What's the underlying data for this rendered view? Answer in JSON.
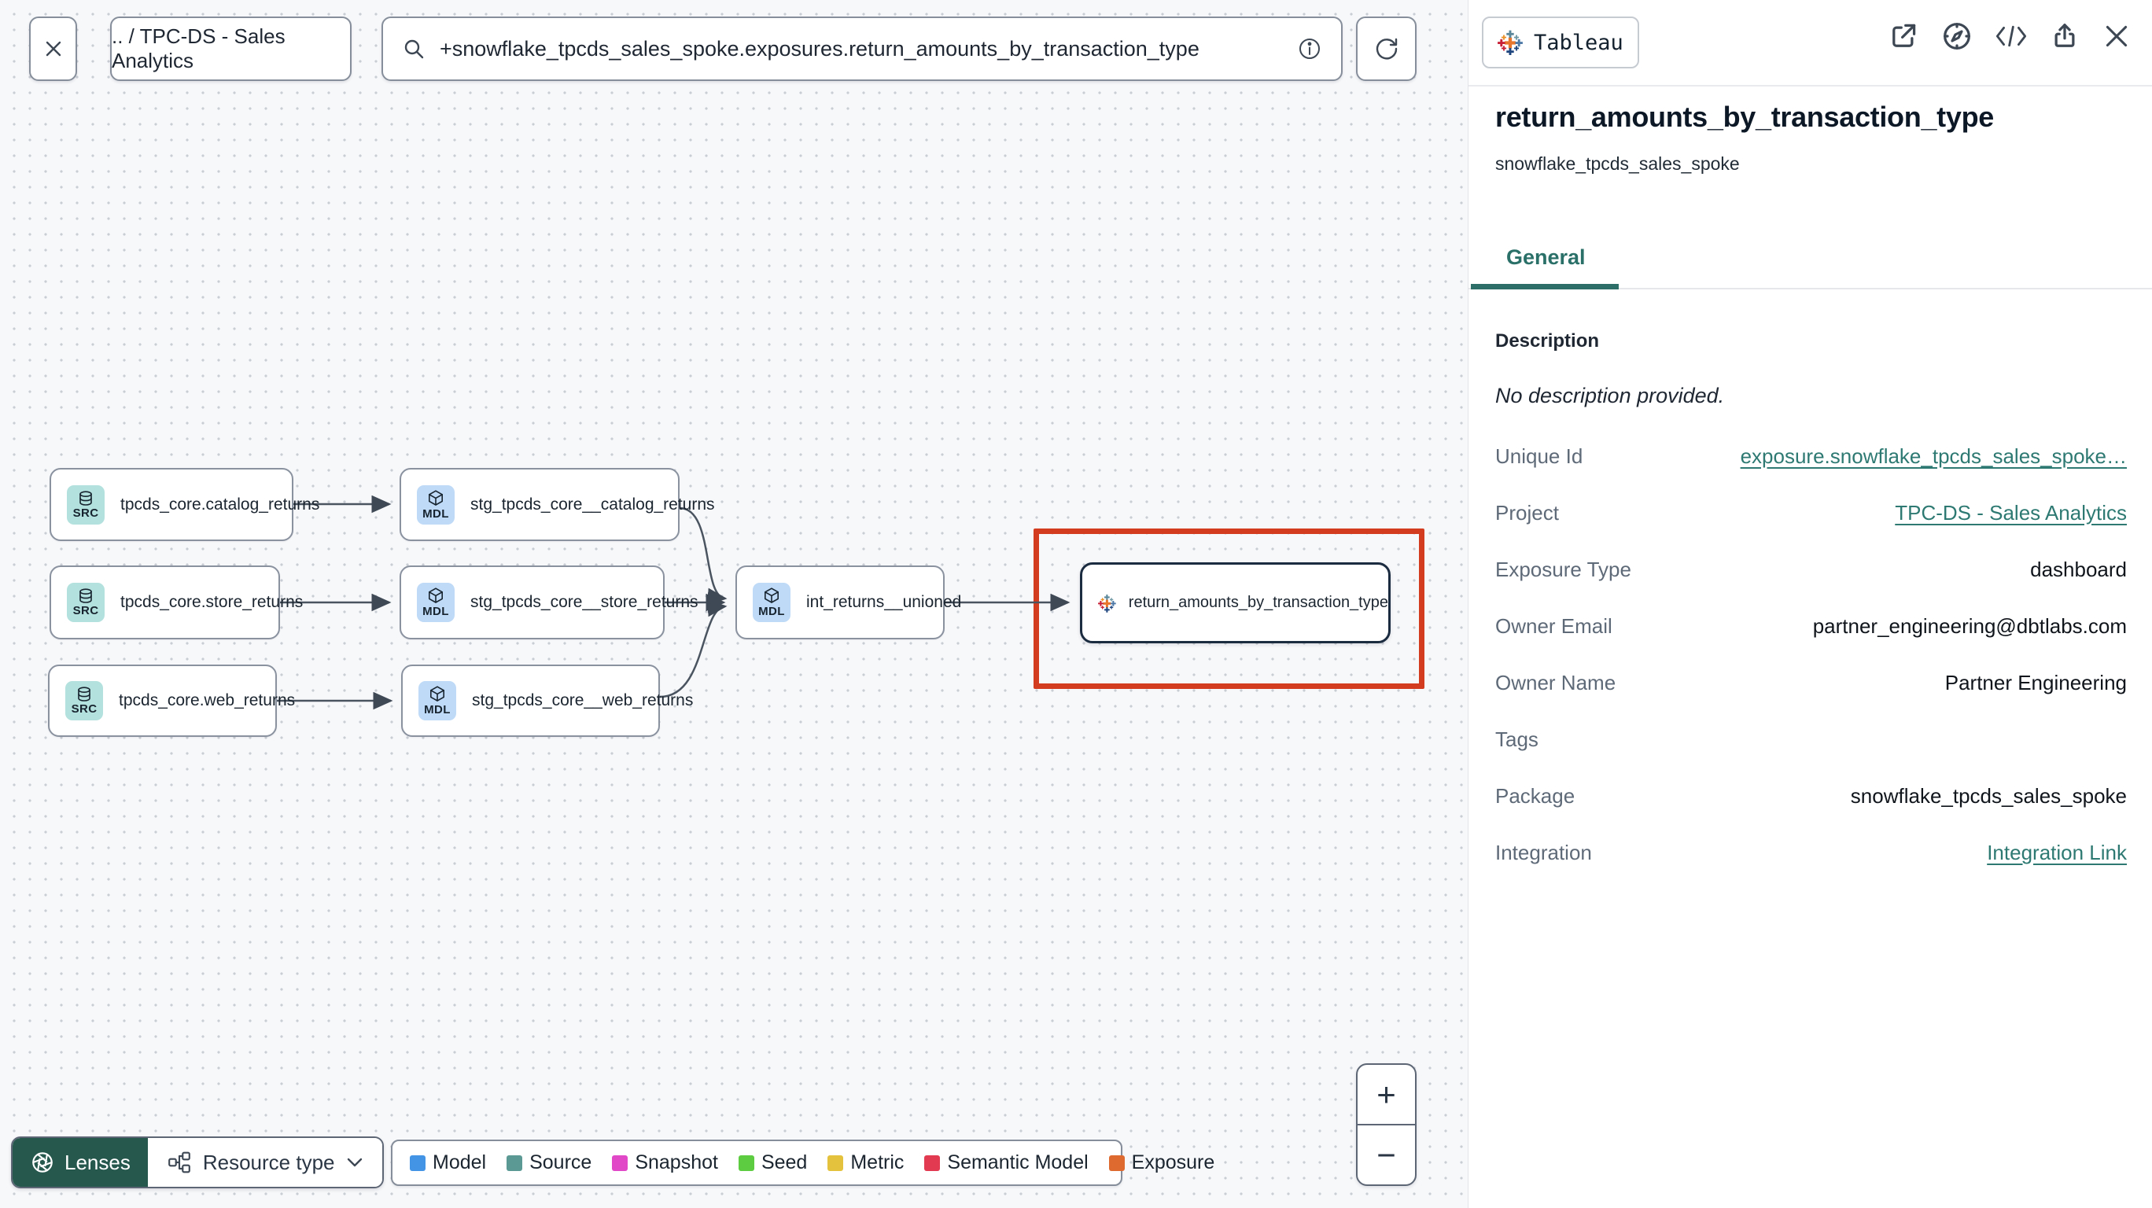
{
  "toolbar": {
    "breadcrumb": ".. / TPC-DS - Sales Analytics",
    "search_value": "+snowflake_tpcds_sales_spoke.exposures.return_amounts_by_transaction_type"
  },
  "graph": {
    "nodes": [
      {
        "badge": "SRC",
        "type": "source",
        "label": "tpcds_core.catalog_returns"
      },
      {
        "badge": "SRC",
        "type": "source",
        "label": "tpcds_core.store_returns"
      },
      {
        "badge": "SRC",
        "type": "source",
        "label": "tpcds_core.web_returns"
      },
      {
        "badge": "MDL",
        "type": "model",
        "label": "stg_tpcds_core__catalog_returns"
      },
      {
        "badge": "MDL",
        "type": "model",
        "label": "stg_tpcds_core__store_returns"
      },
      {
        "badge": "MDL",
        "type": "model",
        "label": "stg_tpcds_core__web_returns"
      },
      {
        "badge": "MDL",
        "type": "model",
        "label": "int_returns__unioned"
      },
      {
        "type": "exposure",
        "integration": "Tableau",
        "label": "return_amounts_by_transaction_type"
      }
    ]
  },
  "controls": {
    "lenses_label": "Lenses",
    "resource_type_label": "Resource type",
    "zoom_in": "+",
    "zoom_out": "−"
  },
  "legend": {
    "items": [
      {
        "label": "Model",
        "color": "#4394e5"
      },
      {
        "label": "Source",
        "color": "#5b9a94"
      },
      {
        "label": "Snapshot",
        "color": "#e048c8"
      },
      {
        "label": "Seed",
        "color": "#5ecc41"
      },
      {
        "label": "Metric",
        "color": "#e4c23d"
      },
      {
        "label": "Semantic Model",
        "color": "#e23a50"
      },
      {
        "label": "Exposure",
        "color": "#df6a30"
      }
    ]
  },
  "panel": {
    "integration_badge": "Tableau",
    "title": "return_amounts_by_transaction_type",
    "subtitle": "snowflake_tpcds_sales_spoke",
    "tab": "General",
    "description_heading": "Description",
    "description_empty": "No description provided.",
    "fields": [
      {
        "label": "Unique Id",
        "value": "exposure.snowflake_tpcds_sales_spoke…",
        "is_link": true
      },
      {
        "label": "Project",
        "value": "TPC-DS - Sales Analytics",
        "is_link": true
      },
      {
        "label": "Exposure Type",
        "value": "dashboard",
        "is_link": false
      },
      {
        "label": "Owner Email",
        "value": "partner_engineering@dbtlabs.com",
        "is_link": false
      },
      {
        "label": "Owner Name",
        "value": "Partner Engineering",
        "is_link": false
      },
      {
        "label": "Tags",
        "value": "",
        "is_link": false
      },
      {
        "label": "Package",
        "value": "snowflake_tpcds_sales_spoke",
        "is_link": false
      },
      {
        "label": "Integration",
        "value": "Integration Link",
        "is_link": true
      }
    ]
  },
  "colors": {
    "accent_teal": "#2a6f68",
    "selection_red": "#d43c20",
    "source_badge_bg": "#b3e1dd",
    "model_badge_bg": "#bedaf7",
    "lenses_bg": "#26584e",
    "edge": "#3f4956"
  }
}
